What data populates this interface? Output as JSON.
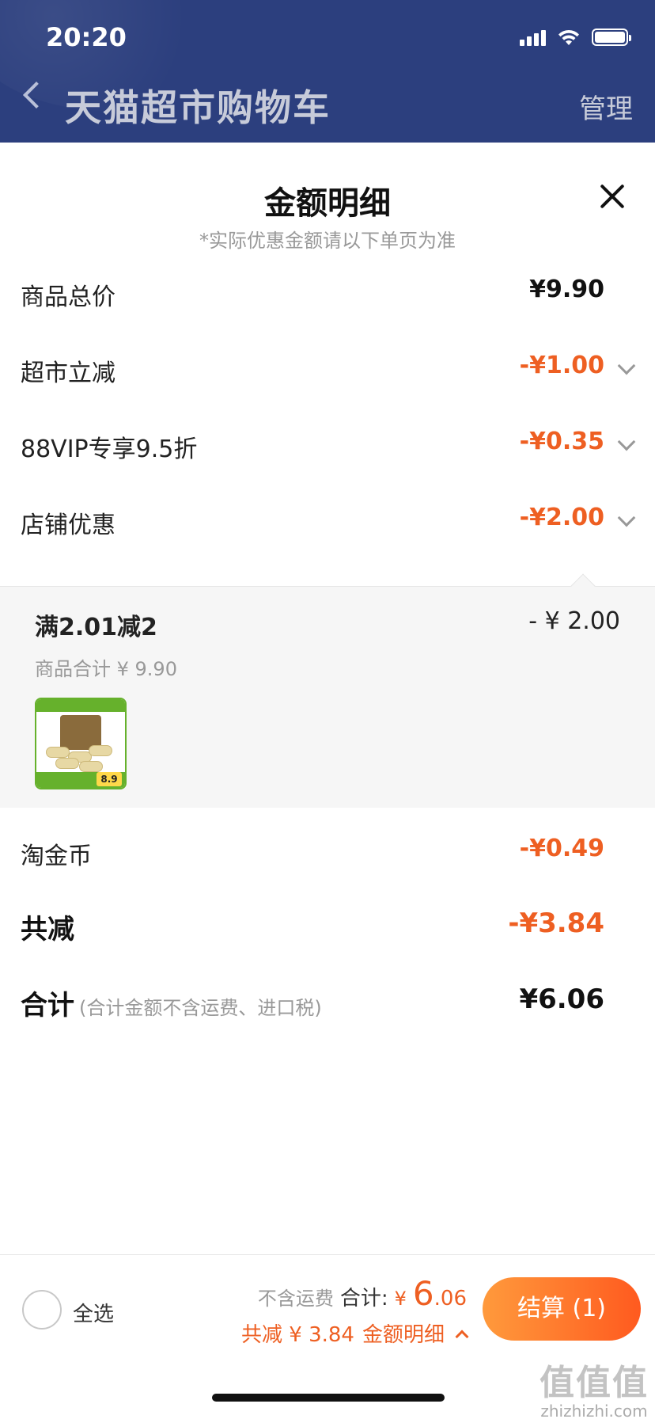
{
  "status_bar": {
    "time": "20:20",
    "battery_level": 1.0
  },
  "header": {
    "title": "天猫超市购物车",
    "manage": "管理"
  },
  "sheet": {
    "title": "金额明细",
    "subtitle": "*实际优惠金额请以下单页为准",
    "rows": [
      {
        "label": "商品总价",
        "value": "¥9.90"
      },
      {
        "label": "超市立减",
        "value": "-¥1.00"
      },
      {
        "label": "88VIP专享9.5折",
        "value": "-¥0.35"
      },
      {
        "label": "店铺优惠",
        "value": "-¥2.00"
      },
      {
        "label": "淘金币",
        "value": "-¥0.49"
      }
    ],
    "shop_detail": {
      "promo_title": "满2.01减2",
      "promo_amount": "- ¥ 2.00",
      "subtotal": "商品合计 ¥ 9.90",
      "thumb_price": "8.9"
    },
    "total_reduction": {
      "label": "共减",
      "value": "-¥3.84"
    },
    "sum": {
      "label": "合计",
      "note": "(合计金额不含运费、进口税)",
      "value": "¥6.06"
    }
  },
  "bottom_bar": {
    "select_all": "全选",
    "shipping_note": "不含运费",
    "total_label": "合计:",
    "currency": "¥",
    "total_big": "6",
    "total_small": ".06",
    "reduction_text": "共减 ¥ 3.84",
    "detail_link": "金额明细",
    "checkout": "结算 (1)"
  },
  "watermark": {
    "main": "值值值",
    "sub": "zhizhizhi.com"
  },
  "colors": {
    "header_bg": "#2c3f7e",
    "accent": "#ee5f22",
    "checkout_start": "#ff9a3c",
    "checkout_end": "#ff5a1f"
  }
}
